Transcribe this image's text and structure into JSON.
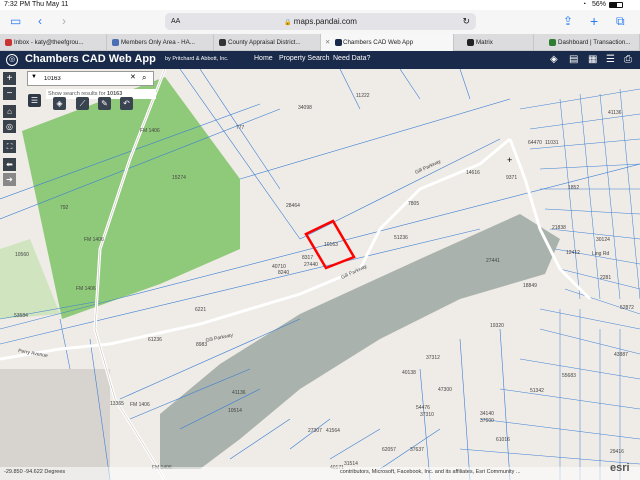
{
  "status": {
    "time": "7:32 PM",
    "date": "Thu May 11",
    "battery": "56%"
  },
  "safari": {
    "text_size": "AA",
    "url": "maps.pandai.com"
  },
  "tabs": [
    {
      "label": "Inbox - katy@theefgrou...",
      "favicon_color": "#c33"
    },
    {
      "label": "Members Only Area - HA...",
      "favicon_color": "#4a6fb5"
    },
    {
      "label": "County Appraisal District...",
      "favicon_color": "#333"
    },
    {
      "label": "Chambers CAD Web App",
      "favicon_color": "#1a2a4a"
    },
    {
      "label": "Matrix",
      "favicon_color": "#222"
    },
    {
      "label": "Dashboard | Transaction...",
      "favicon_color": "#2e7d32"
    }
  ],
  "app": {
    "title": "Chambers CAD Web App",
    "byline": "by Pritchard & Abbott, Inc.",
    "nav": [
      "Home",
      "Property Search",
      "Need Data?"
    ]
  },
  "search": {
    "value": "10163",
    "hint_prefix": "Show search results for",
    "hint_term": "10163"
  },
  "map": {
    "labels": [
      "10163",
      "28464",
      "51236",
      "40710",
      "8317",
      "27440",
      "8240",
      "15274",
      "792",
      "10560",
      "53584",
      "777",
      "34098",
      "11222",
      "6221",
      "8983",
      "61236",
      "13365",
      "10514",
      "18849",
      "19320",
      "41136",
      "64470",
      "11031",
      "14616",
      "40138",
      "11222",
      "37312",
      "27307",
      "41564",
      "31514",
      "40171",
      "62057",
      "37637",
      "47300",
      "54476",
      "37310",
      "34140",
      "37600",
      "61016",
      "51342",
      "55683",
      "43887",
      "29416",
      "52872",
      "30124",
      "2281",
      "12412",
      "21838",
      "1852",
      "9371",
      "7805",
      "27441"
    ],
    "roads": [
      "Gill Parkway",
      "Gill Parkway",
      "Gill Parkway",
      "Perry Avenue",
      "FM 1406",
      "FM 1406",
      "FM 1406",
      "FM 1406",
      "FM 1406",
      "Ling Rd"
    ],
    "red_parcel_label": "10163"
  },
  "footer": {
    "coords": "-29.850 -94.622 Degrees",
    "attribution": "contributors, Microsoft, Facebook, Inc. and its affiliates, Esri Community ...",
    "esri": "esri"
  },
  "colors": {
    "appbar": "#1a2a4a",
    "parcel_line": "#3a7fd5",
    "highlight": "#ff0000",
    "field": "#8fc97a",
    "subdivision": "#a9b2ac"
  }
}
